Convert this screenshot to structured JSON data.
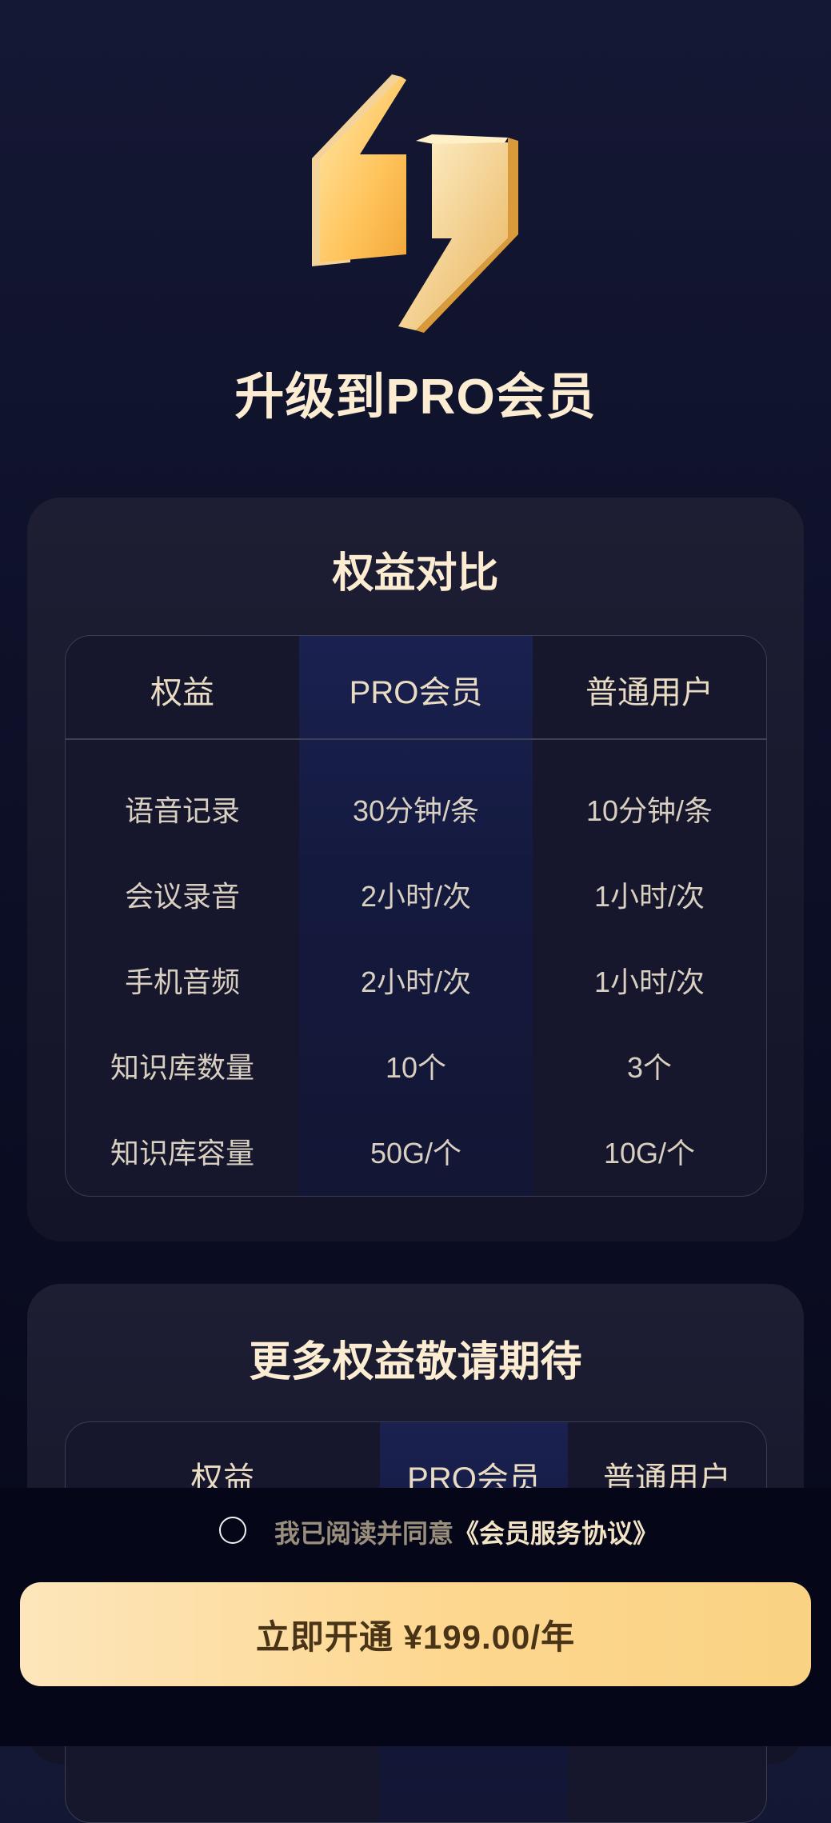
{
  "header": {
    "title": "升级到PRO会员"
  },
  "comparison": {
    "title": "权益对比",
    "columns": [
      "权益",
      "PRO会员",
      "普通用户"
    ],
    "rows": [
      [
        "语音记录",
        "30分钟/条",
        "10分钟/条"
      ],
      [
        "会议录音",
        "2小时/次",
        "1小时/次"
      ],
      [
        "手机音频",
        "2小时/次",
        "1小时/次"
      ],
      [
        "知识库数量",
        "10个",
        "3个"
      ],
      [
        "知识库容量",
        "50G/个",
        "10G/个"
      ]
    ]
  },
  "more": {
    "title": "更多权益敬请期待",
    "columns": [
      "权益",
      "PRO会员",
      "普通用户"
    ]
  },
  "agreement": {
    "prefix": "我已阅读并同意",
    "link": "《会员服务协议》",
    "checked": false
  },
  "purchase": {
    "label": "立即开通 ¥199.00/年"
  },
  "colors": {
    "background": "#0e1129",
    "gold": "#fbecd2",
    "button": "#fdd78f",
    "pro_column": "#1a2150"
  },
  "icons": {
    "logo": "gold-quote-logo-icon",
    "radio": "radio-unchecked-icon"
  }
}
